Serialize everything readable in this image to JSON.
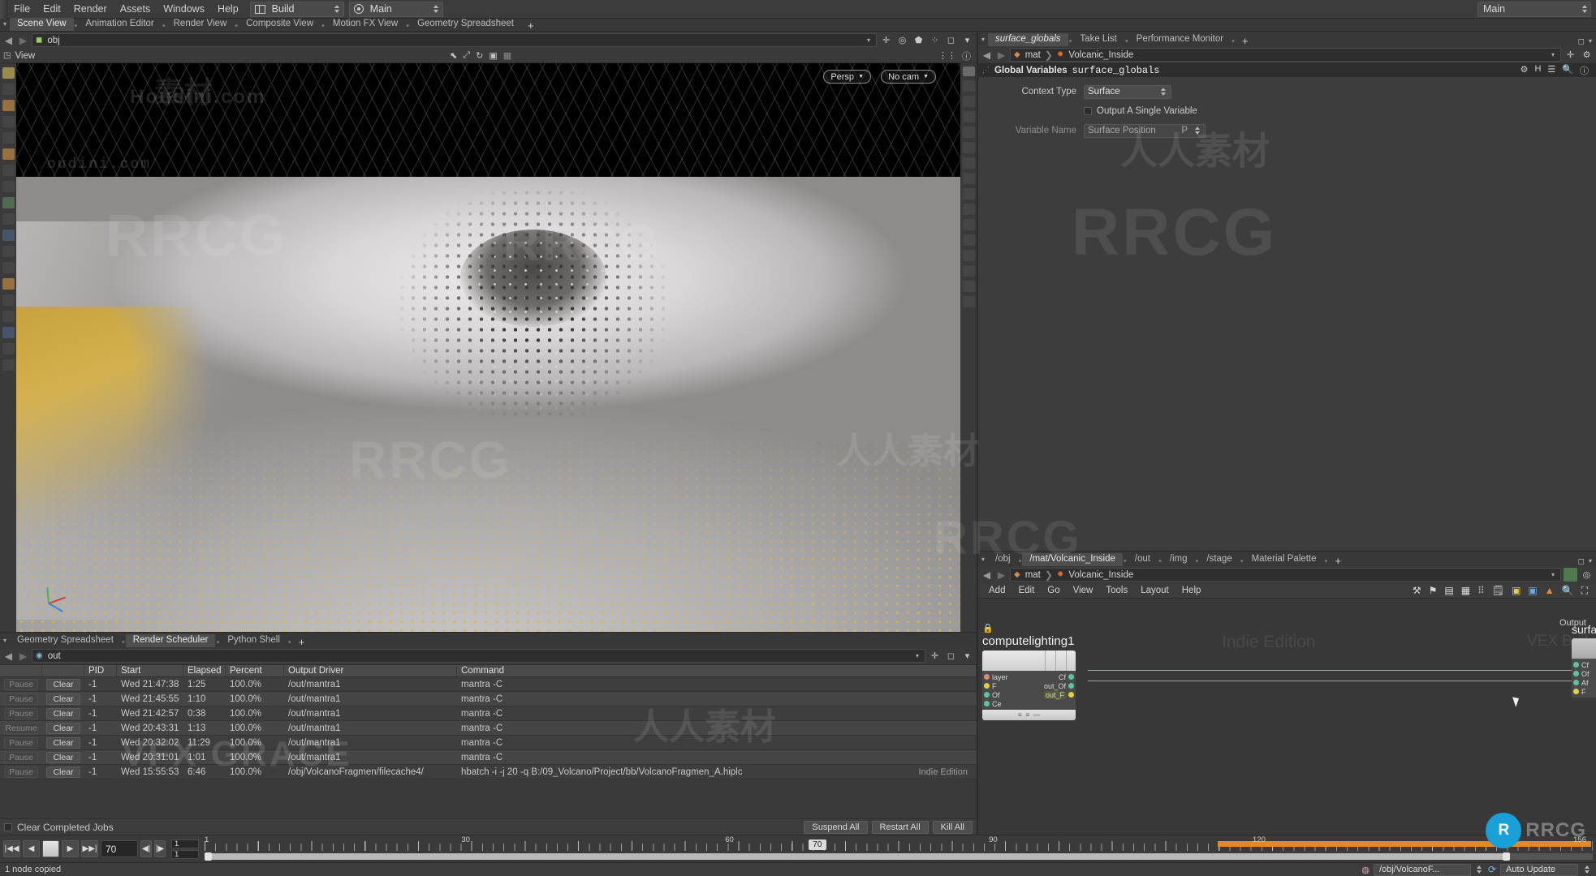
{
  "menubar": {
    "items": [
      "File",
      "Edit",
      "Render",
      "Assets",
      "Windows",
      "Help"
    ],
    "build_label": "Build",
    "main_label": "Main",
    "right_main_label": "Main"
  },
  "desktop_tabs": {
    "tabs": [
      "Scene View",
      "Animation Editor",
      "Render View",
      "Composite View",
      "Motion FX View",
      "Geometry Spreadsheet"
    ],
    "active": "Scene View",
    "add_label": "+"
  },
  "scene": {
    "pathbar": {
      "crumb": "obj"
    },
    "viewport_label": "View",
    "view_mode": "Persp",
    "camera": "No cam",
    "caret": "▾",
    "watermarks": [
      "Houdini.com",
      "oudini.com",
      "RRCG",
      "RRCG",
      "RRCG",
      "RRCG",
      "人人素材"
    ]
  },
  "render_scheduler": {
    "tabs": [
      "Geometry Spreadsheet",
      "Render Scheduler",
      "Python Shell"
    ],
    "active": "Render Scheduler",
    "add_label": "+",
    "pathbar": {
      "crumb": "out"
    },
    "columns": [
      "",
      "",
      "PID",
      "Start",
      "Elapsed",
      "Percent",
      "Output Driver",
      "Command"
    ],
    "rows": [
      {
        "action": "Pause",
        "clear": "Clear",
        "pid": "-1",
        "start": "Wed 21:47:38",
        "elapsed": "1:25",
        "percent": "100.0%",
        "driver": "/out/mantra1",
        "command": "mantra -C"
      },
      {
        "action": "Pause",
        "clear": "Clear",
        "pid": "-1",
        "start": "Wed 21:45:55",
        "elapsed": "1:10",
        "percent": "100.0%",
        "driver": "/out/mantra1",
        "command": "mantra -C"
      },
      {
        "action": "Pause",
        "clear": "Clear",
        "pid": "-1",
        "start": "Wed 21:42:57",
        "elapsed": "0:38",
        "percent": "100.0%",
        "driver": "/out/mantra1",
        "command": "mantra -C"
      },
      {
        "action": "Resume",
        "clear": "Clear",
        "pid": "-1",
        "start": "Wed 20:43:31",
        "elapsed": "1:13",
        "percent": "100.0%",
        "driver": "/out/mantra1",
        "command": "mantra -C"
      },
      {
        "action": "Pause",
        "clear": "Clear",
        "pid": "-1",
        "start": "Wed 20:32:02",
        "elapsed": "11:29",
        "percent": "100.0%",
        "driver": "/out/mantra1",
        "command": "mantra -C"
      },
      {
        "action": "Pause",
        "clear": "Clear",
        "pid": "-1",
        "start": "Wed 20:31:01",
        "elapsed": "1:01",
        "percent": "100.0%",
        "driver": "/out/mantra1",
        "command": "mantra -C"
      },
      {
        "action": "Pause",
        "clear": "Clear",
        "pid": "-1",
        "start": "Wed 15:55:53",
        "elapsed": "6:46",
        "percent": "100.0%",
        "driver": "/obj/VolcanoFragmen/filecache4/",
        "command": "hbatch -i -j 20 -q B:/09_Volcano/Project/bb/VolcanoFragmen_A.hiplc"
      }
    ],
    "footer": {
      "clear_completed": "Clear Completed Jobs",
      "suspend_all": "Suspend All",
      "restart_all": "Restart All",
      "kill_all": "Kill All",
      "edition": "Indie Edition"
    }
  },
  "parameters": {
    "tabs": [
      "surface_globals",
      "Take List",
      "Performance Monitor"
    ],
    "active": "surface_globals",
    "add_label": "+",
    "breadcrumb": [
      "mat",
      "Volcanic_Inside"
    ],
    "header_group": "Global Variables",
    "header_node": "surface_globals",
    "rows": [
      {
        "label": "Context Type",
        "value": "Surface",
        "kind": "menu"
      },
      {
        "label": "",
        "value": "Output A Single Variable",
        "kind": "toggle",
        "checked": false
      },
      {
        "label": "Variable Name",
        "value": "Surface Position",
        "suffix": "P",
        "kind": "menu"
      }
    ]
  },
  "network": {
    "tabs": [
      "/obj",
      "/mat/Volcanic_Inside",
      "/out",
      "/img",
      "/stage",
      "Material Palette"
    ],
    "active": "/mat/Volcanic_Inside",
    "add_label": "+",
    "breadcrumb": [
      "mat",
      "Volcanic_Inside"
    ],
    "menu": [
      "Add",
      "Edit",
      "Go",
      "View",
      "Tools",
      "Layout",
      "Help"
    ],
    "node": {
      "name": "computelighting1",
      "inputs": [
        {
          "label": "layer",
          "color": "#d98c6a"
        },
        {
          "label": "F",
          "color": "#e3d040"
        },
        {
          "label": "Of",
          "color": "#5fc3a2"
        },
        {
          "label": "Ce",
          "color": "#5fc3a2"
        }
      ],
      "outputs": [
        {
          "label": "Cf",
          "color": "#5fc3a2"
        },
        {
          "label": "out_Of",
          "color": "#5fc3a2"
        },
        {
          "label": "out_F",
          "color": "#e3d040"
        }
      ]
    },
    "right_node": {
      "title": "surfa",
      "output_label": "Output",
      "ports": [
        "Cf",
        "Of",
        "Af",
        "F"
      ]
    },
    "watermarks": [
      "Indie Edition",
      "VEX Buil"
    ]
  },
  "playbar": {
    "current_frame": "70",
    "range_start": "1",
    "range_end": "1",
    "global_start": "1",
    "playhead_label": "70",
    "tick_labels": [
      "1",
      "30",
      "60",
      "90",
      "120",
      "156"
    ],
    "buttons": [
      "skip-start",
      "step-back",
      "stop",
      "play",
      "skip-end",
      "key-prev",
      "key-next"
    ]
  },
  "statusbar": {
    "message": "1 node copied",
    "node_path": "/obj/VolcanoF...",
    "update_mode": "Auto Update"
  },
  "colors": {
    "accent_orange": "#e08a28",
    "panel_bg": "#3a3a3a",
    "dark_bg": "#2d2d2d",
    "text": "#c8c8c8",
    "brand_blue": "#19a0d8",
    "sulfur": "#d4b14e"
  }
}
